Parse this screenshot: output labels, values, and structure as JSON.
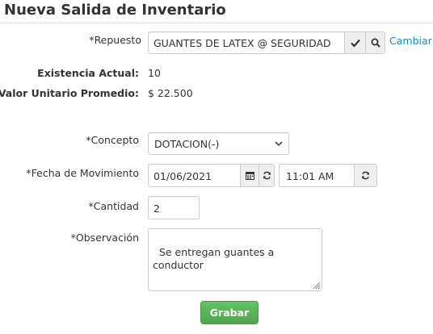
{
  "page": {
    "title": "Nueva Salida de Inventario"
  },
  "repuesto": {
    "label": "*Repuesto",
    "value": "GUANTES DE LATEX @ SEGURIDAD",
    "cambiar_label": "Cambiar",
    "confirm_icon": "check-icon",
    "search_icon": "search-icon"
  },
  "existencia": {
    "label": "Existencia Actual:",
    "value": "10"
  },
  "valor": {
    "label": "Valor Unitario Promedio:",
    "value": "$ 22.500"
  },
  "concepto": {
    "label": "*Concepto",
    "selected": "DOTACION(-)"
  },
  "fecha": {
    "label": "*Fecha de Movimiento",
    "date": "01/06/2021",
    "time": "11:01 AM",
    "calendar_icon": "calendar-icon",
    "refresh_icon": "refresh-icon"
  },
  "cantidad": {
    "label": "*Cantidad",
    "value": "2"
  },
  "observacion": {
    "label": "*Observación",
    "value": "Se entregan guantes a\nconductor"
  },
  "actions": {
    "save_label": "Grabar"
  },
  "colors": {
    "link": "#1a8bb8",
    "save_button": "#5bb75b",
    "border": "#cccccc"
  }
}
